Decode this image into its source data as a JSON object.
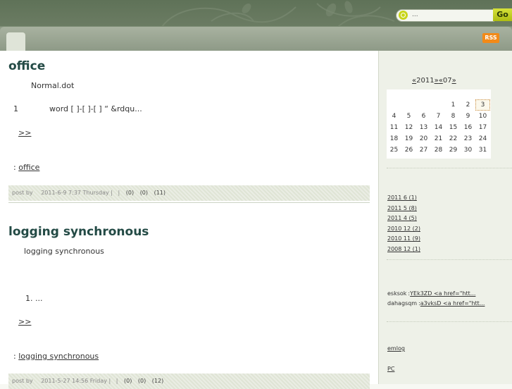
{
  "header": {
    "search_value": "...",
    "go_label": "Go",
    "rss_label": "RSS"
  },
  "posts": [
    {
      "title": "office",
      "line1": "Normal.dot",
      "line2_num": "1",
      "line2_text": "word    [ ]-[ ]-[    ]    “    &rdqu...",
      "more": ">>",
      "tags_prefix": ":",
      "tag": "office",
      "foot_postby": "post by",
      "foot_date": "2011-6-9 7:37 Thursday |",
      "foot_sep": "|",
      "foot_c1": "(0)",
      "foot_c2": "(0)",
      "foot_c3": "(11)"
    },
    {
      "title": "logging synchronous",
      "line1": "logging synchronous",
      "list_item": "1.    ...",
      "more": ">>",
      "tags_prefix": ":",
      "tag": "logging synchronous",
      "foot_postby": "post by",
      "foot_date": "2011-5-27 14:56 Friday |",
      "foot_sep": "|",
      "foot_c1": "(0)",
      "foot_c2": "(0)",
      "foot_c3": "(12)"
    }
  ],
  "calendar": {
    "prev_year": "«",
    "year": "2011",
    "next_year": "»",
    "prev_month": "«",
    "month": "07",
    "next_month": "»",
    "rows": [
      [
        "",
        "",
        "",
        "",
        "1",
        "2",
        "3"
      ],
      [
        "4",
        "5",
        "6",
        "7",
        "8",
        "9",
        "10"
      ],
      [
        "11",
        "12",
        "13",
        "14",
        "15",
        "16",
        "17"
      ],
      [
        "18",
        "19",
        "20",
        "21",
        "22",
        "23",
        "24"
      ],
      [
        "25",
        "26",
        "27",
        "28",
        "29",
        "30",
        "31"
      ]
    ],
    "today": "3"
  },
  "archives": [
    "2011 6 (1)",
    "2011 5 (8)",
    "2011 4 (5)",
    "2010 12 (2)",
    "2010 11 (9)",
    "2008 12 (1)"
  ],
  "comments": [
    {
      "author": "esksok",
      "sep": ":",
      "text": "YEk3ZD  <a href=\"htt..."
    },
    {
      "author": "dahagsqm",
      "sep": ":",
      "text": "a3vksD  <a href=\"htt..."
    }
  ],
  "links": [
    "emlog",
    "",
    "PC",
    ""
  ],
  "colors": {
    "accent": "#234a45",
    "go": "#c8d51a",
    "rss": "#f28a18"
  }
}
